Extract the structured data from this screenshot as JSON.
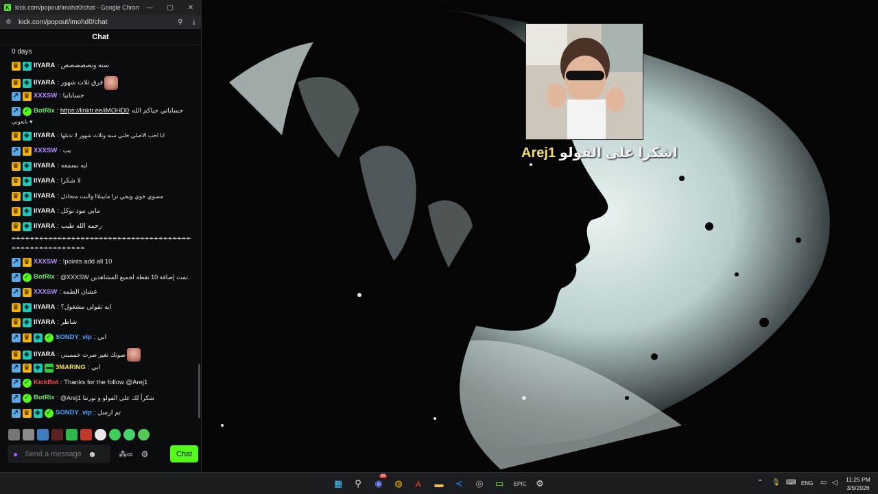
{
  "window": {
    "title": "kick.com/popout/imohd0/chat - Google Chrome",
    "url": "kick.com/popout/imohd0/chat"
  },
  "chat": {
    "header": "Chat",
    "streak": "0 days",
    "messages": [
      {
        "user": "IIYARA",
        "text": "سنه ونصصصصص"
      },
      {
        "user": "IIYARA",
        "text": "فرق ثلاث شهور"
      },
      {
        "user": "XXXSW",
        "text": "حسابانيا"
      },
      {
        "user": "BotRix",
        "link": "https://linktr.ee/iMOHD0",
        "text": "حساباتي حياكم الله",
        "text2": "تابعوني ♥"
      },
      {
        "user": "IIYARA",
        "text": "انا احب الاصلي خلني سنه وثلاث شهور لا تدبلها"
      },
      {
        "user": "XXXSW",
        "text": "يب"
      },
      {
        "user": "IIYARA",
        "text": "ايه نسمعه"
      },
      {
        "user": "IIYARA",
        "text": "لا شكرا"
      },
      {
        "user": "IIYARA",
        "text": "مسوي خوي ويجي ترا مابينلاا والنت متخاذل"
      },
      {
        "user": "IIYARA",
        "text": "مابي مود نوكل"
      },
      {
        "user": "IIYARA",
        "text": "رحمه الله طيب"
      },
      {
        "spam1": "↞↞↞↞↞↞↞↞↞↞↞↞↞↞↞↞↞↞↞↞↞↞↞↞↞↞↞↞↞↞↞↞↞↞↞↞↞↞↞↞↞↞↞↞↞↞↞↞↞↞↞↞↞↞↞↞↞↞↞↞↞↞",
        "spam2": "↞↞↞↞↞↞↞↞↞↞↞↞↞↞↞↞"
      },
      {
        "user": "XXXSW",
        "text": "!points add all 10"
      },
      {
        "user": "BotRix",
        "text": "@XXXSW تمت إضافة 10 نقطة لجميع المشاهدين."
      },
      {
        "user": "XXXSW",
        "text": "عشان الطمه"
      },
      {
        "user": "IIYARA",
        "text": "ايه تقولي مشغول؟"
      },
      {
        "user": "IIYARA",
        "text": "شاطر"
      },
      {
        "user": "SONDY_vip",
        "text": "ابي"
      },
      {
        "user": "IIYARA",
        "text": "صوتك تغير صرت خممبني"
      },
      {
        "user": "3MARING",
        "text": "ابي"
      },
      {
        "user": "KickBot",
        "text": "Thanks for the follow @Arej1"
      },
      {
        "user": "BotRix",
        "text": "@Arej1 شكراً لك على الفولو و نورتنا"
      },
      {
        "user": "SONDY_vip",
        "text": "تم ارسل"
      }
    ],
    "input_placeholder": "Send a message",
    "send_label": "Chat"
  },
  "alert": {
    "text": "اشكرا على الفولو",
    "username": "Arej1"
  },
  "taskbar": {
    "language": "ENG",
    "time": "11:25 PM",
    "date": "3/5/2026",
    "discord_badge": "99"
  },
  "colors": {
    "kick_green": "#53fc18",
    "chat_bg": "#0b0c0e",
    "taskbar_bg": "#1c1d21"
  }
}
